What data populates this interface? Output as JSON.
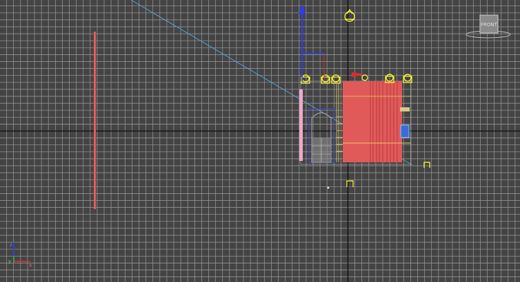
{
  "viewport": {
    "name": "Front",
    "view_cube": {
      "face_label": "FRONT",
      "face_color": "#8a8a8a"
    }
  },
  "colors": {
    "background": "#444444",
    "grid_minor": "#9e9e9e",
    "grid_major": "#111111",
    "selected_wire": "#ffff00",
    "object_red": "#e05a5a",
    "guide_line": "#4fa6d8",
    "axis_x": "#e03030",
    "axis_y": "#30c030",
    "axis_z": "#2a3cff"
  },
  "gizmo": {
    "x_label": "x",
    "y_label": "y",
    "z_label": "z"
  },
  "icons": [
    "view-cube-icon",
    "omni-light-icon",
    "target-camera-icon",
    "world-axis-tripod-icon",
    "move-gizmo-icon"
  ]
}
